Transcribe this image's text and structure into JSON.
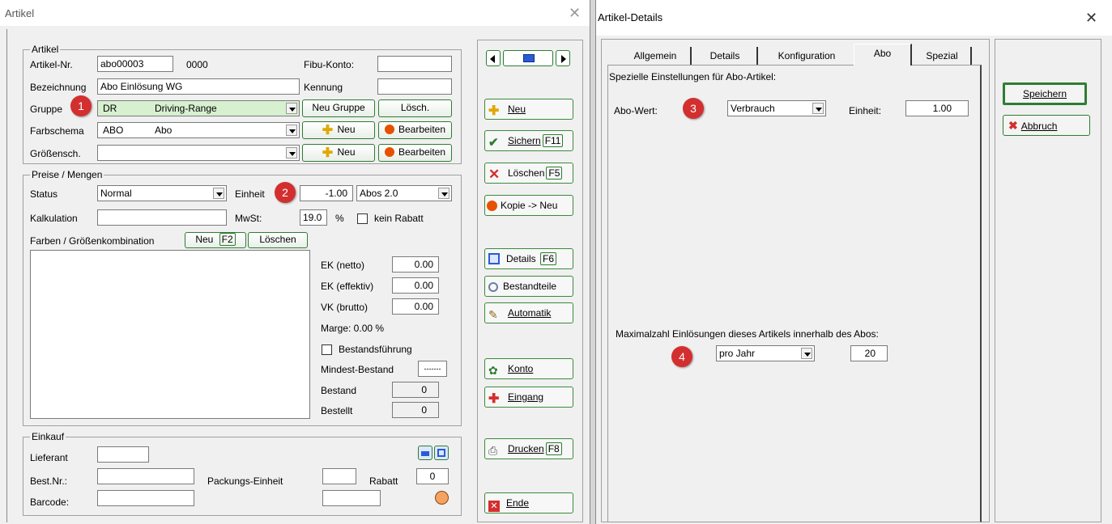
{
  "left_window": {
    "title": "Artikel",
    "close": "✕",
    "artikel_group": {
      "label": "Artikel",
      "artikel_nr_label": "Artikel-Nr.",
      "artikel_nr": "abo00003",
      "artikel_nr_suffix": "0000",
      "fibu_konto_label": "Fibu-Konto:",
      "fibu_konto": "",
      "bezeichnung_label": "Bezeichnung",
      "bezeichnung": "Abo Einlösung WG",
      "kennung_label": "Kennung",
      "kennung": "",
      "gruppe_label": "Gruppe",
      "gruppe_code": "DR",
      "gruppe_name": "Driving-Range",
      "neu_gruppe": "Neu Gruppe",
      "loesch": "Lösch.",
      "farbschema_label": "Farbschema",
      "farbschema_code": "ABO",
      "farbschema_name": "Abo",
      "neu": "Neu",
      "bearbeiten": "Bearbeiten",
      "groessensch_label": "Größensch.",
      "groessensch": ""
    },
    "preise_group": {
      "label": "Preise / Mengen",
      "status_label": "Status",
      "status": "Normal",
      "einheit_label": "Einheit",
      "einheit_value": "-1.00",
      "einheit_unit": "Abos 2.0",
      "kalkulation_label": "Kalkulation",
      "kalkulation": "",
      "mwst_label": "MwSt:",
      "mwst": "19.0",
      "percent": "%",
      "kein_rabatt": "kein Rabatt",
      "farben_label": "Farben / Größenkombination",
      "neu_f2": "Neu",
      "f2": "F2",
      "loeschen": "Löschen",
      "ek_netto_label": "EK (netto)",
      "ek_netto": "0.00",
      "ek_effektiv_label": "EK (effektiv)",
      "ek_effektiv": "0.00",
      "vk_brutto_label": "VK (brutto)",
      "vk_brutto": "0.00",
      "marge": "Marge: 0.00 %",
      "bestandsfuehrung": "Bestandsführung",
      "mindest_bestand_label": "Mindest-Bestand",
      "mindest_bestand": "-------",
      "bestand_label": "Bestand",
      "bestand": "0",
      "bestellt_label": "Bestellt",
      "bestellt": "0"
    },
    "einkauf_group": {
      "label": "Einkauf",
      "lieferant_label": "Lieferant",
      "best_nr_label": "Best.Nr.:",
      "packungs_label": "Packungs-Einheit",
      "rabatt_label": "Rabatt",
      "rabatt": "0",
      "barcode_label": "Barcode:"
    },
    "side_buttons": {
      "neu": "Neu",
      "sichern": "Sichern",
      "sichern_key": "F11",
      "loeschen": "Löschen",
      "loeschen_key": "F5",
      "kopie": "Kopie -> Neu",
      "details": "Details",
      "details_key": "F6",
      "bestandteile": "Bestandteile",
      "automatik": "Automatik",
      "konto": "Konto",
      "eingang": "Eingang",
      "drucken": "Drucken",
      "drucken_key": "F8",
      "ende": "Ende"
    }
  },
  "right_window": {
    "title": "Artikel-Details",
    "close": "✕",
    "tabs": [
      "Allgemein",
      "Details",
      "Konfiguration",
      "Abo",
      "Spezial"
    ],
    "active_tab": "Abo",
    "heading": "Spezielle Einstellungen für Abo-Artikel:",
    "abo_wert_label": "Abo-Wert:",
    "abo_wert": "Verbrauch",
    "einheit_label": "Einheit:",
    "einheit": "1.00",
    "max_label": "Maximalzahl Einlösungen dieses Artikels innerhalb des Abos:",
    "max_period": "pro Jahr",
    "max_value": "20",
    "speichern": "Speichern",
    "abbruch": "Abbruch"
  },
  "badges": [
    "1",
    "2",
    "3",
    "4"
  ],
  "colors": {
    "badge": "#d32f2f",
    "button_border": "#2e7d32",
    "highlight_green": "#d7f0d0"
  }
}
